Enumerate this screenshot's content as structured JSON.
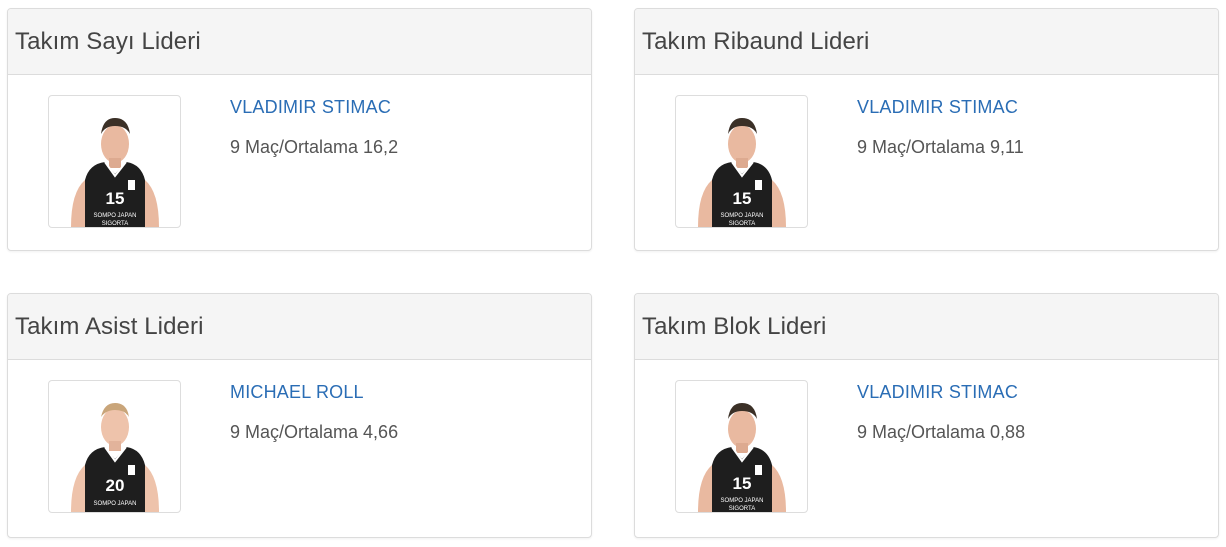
{
  "leaders": [
    {
      "title": "Takım Sayı Lideri",
      "player": "VLADIMIR STIMAC",
      "stat": "9 Maç/Ortalama 16,2",
      "jersey": "15",
      "sponsor1": "SOMPO JAPAN",
      "sponsor2": "SIGORTA"
    },
    {
      "title": "Takım Ribaund Lideri",
      "player": "VLADIMIR STIMAC",
      "stat": "9 Maç/Ortalama 9,11",
      "jersey": "15",
      "sponsor1": "SOMPO JAPAN",
      "sponsor2": "SIGORTA"
    },
    {
      "title": "Takım Asist Lideri",
      "player": "MICHAEL ROLL",
      "stat": "9 Maç/Ortalama 4,66",
      "jersey": "20",
      "sponsor1": "SOMPO JAPAN",
      "sponsor2": ""
    },
    {
      "title": "Takım Blok Lideri",
      "player": "VLADIMIR STIMAC",
      "stat": "9 Maç/Ortalama 0,88",
      "jersey": "15",
      "sponsor1": "SOMPO JAPAN",
      "sponsor2": "SIGORTA"
    }
  ],
  "colors": {
    "link": "#2a6db5",
    "heading_bg": "#f5f5f5",
    "jersey": "#1e1e1e",
    "skin": "#e9b9a0"
  }
}
